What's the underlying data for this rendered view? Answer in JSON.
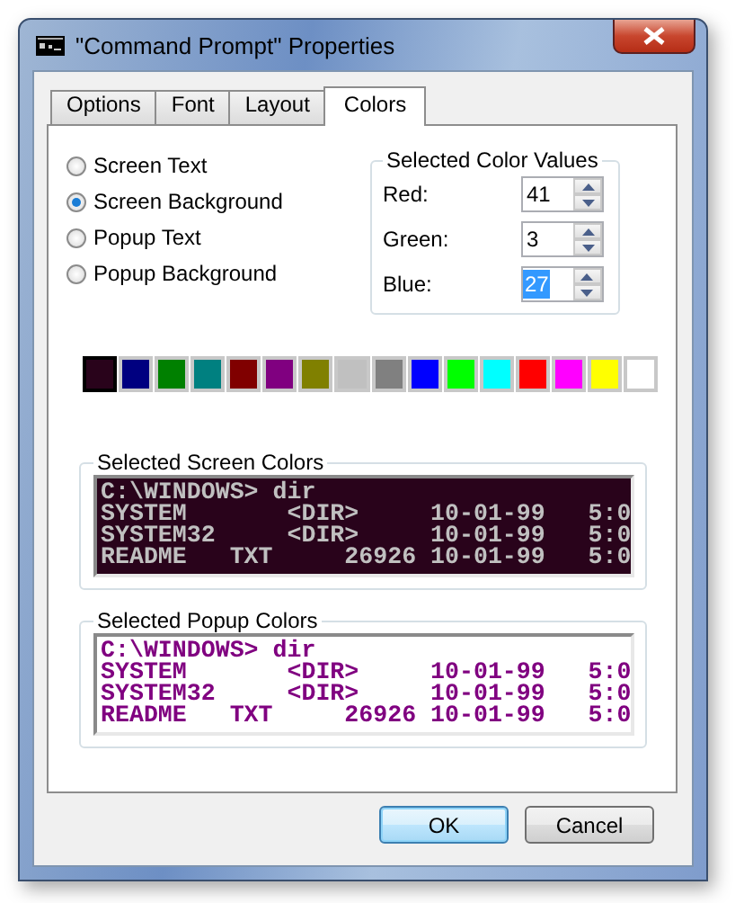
{
  "window": {
    "title": "\"Command Prompt\" Properties"
  },
  "tabs": [
    {
      "label": "Options",
      "selected": false
    },
    {
      "label": "Font",
      "selected": false
    },
    {
      "label": "Layout",
      "selected": false
    },
    {
      "label": "Colors",
      "selected": true
    }
  ],
  "color_targets": [
    {
      "label": "Screen Text",
      "selected": false
    },
    {
      "label": "Screen Background",
      "selected": true
    },
    {
      "label": "Popup Text",
      "selected": false
    },
    {
      "label": "Popup Background",
      "selected": false
    }
  ],
  "color_values": {
    "title": "Selected Color Values",
    "fields": [
      {
        "label": "Red:",
        "value": "41",
        "selected": false
      },
      {
        "label": "Green:",
        "value": "3",
        "selected": false
      },
      {
        "label": "Blue:",
        "value": "27",
        "selected": true
      }
    ]
  },
  "palette": [
    {
      "color": "#29031b",
      "selected": true
    },
    {
      "color": "#000080",
      "selected": false
    },
    {
      "color": "#008000",
      "selected": false
    },
    {
      "color": "#008080",
      "selected": false
    },
    {
      "color": "#800000",
      "selected": false
    },
    {
      "color": "#800080",
      "selected": false
    },
    {
      "color": "#808000",
      "selected": false
    },
    {
      "color": "#c0c0c0",
      "selected": false
    },
    {
      "color": "#808080",
      "selected": false
    },
    {
      "color": "#0000ff",
      "selected": false
    },
    {
      "color": "#00ff00",
      "selected": false
    },
    {
      "color": "#00ffff",
      "selected": false
    },
    {
      "color": "#ff0000",
      "selected": false
    },
    {
      "color": "#ff00ff",
      "selected": false
    },
    {
      "color": "#ffff00",
      "selected": false
    },
    {
      "color": "#ffffff",
      "selected": false
    }
  ],
  "previews": [
    {
      "title": "Selected Screen Colors",
      "color": "#29031b",
      "lines": [
        {
          "text": "C:\\WINDOWS> dir",
          "color": "#c0c0c0"
        },
        {
          "text": "SYSTEM       <DIR>     10-01-99   5:0",
          "color": "#c0c0c0"
        },
        {
          "text": "SYSTEM32     <DIR>     10-01-99   5:0",
          "color": "#c0c0c0"
        },
        {
          "text": "README   TXT     26926 10-01-99   5:0",
          "color": "#c0c0c0"
        }
      ]
    },
    {
      "title": "Selected Popup Colors",
      "color": "#ffffff",
      "lines": [
        {
          "text": "C:\\WINDOWS> dir",
          "color": "#800080"
        },
        {
          "text": "SYSTEM       <DIR>     10-01-99   5:0",
          "color": "#800080"
        },
        {
          "text": "SYSTEM32     <DIR>     10-01-99   5:0",
          "color": "#800080"
        },
        {
          "text": "README   TXT     26926 10-01-99   5:0",
          "color": "#800080"
        }
      ]
    }
  ],
  "buttons": [
    {
      "label": "OK",
      "default": true
    },
    {
      "label": "Cancel",
      "default": false
    }
  ]
}
